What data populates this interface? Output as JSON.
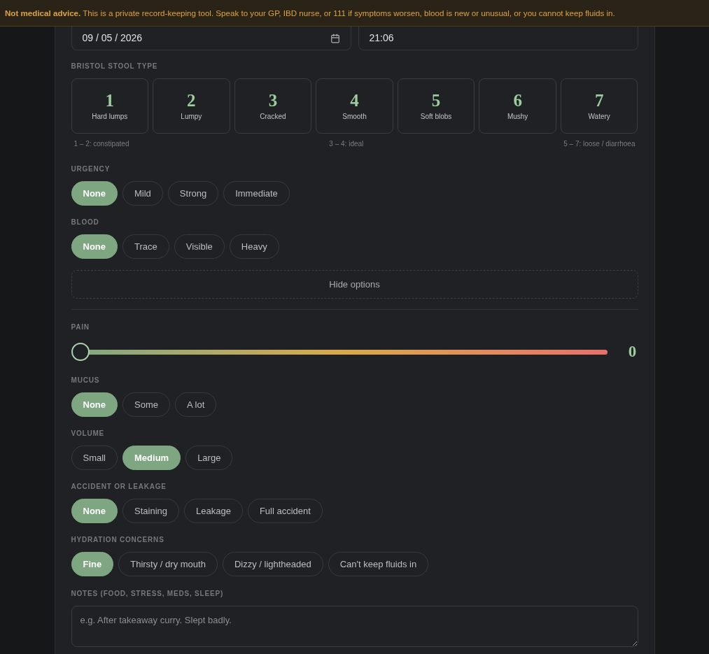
{
  "banner": {
    "text": "**Not medical advice.** This is a private record-keeping tool. Speak to your GP, IBD nurse, or 111 if symptoms worsen, blood is new or unusual, or you cannot keep fluids in."
  },
  "date_field": {
    "value": "09 / 05 / 2026"
  },
  "time_field": {
    "value": "21:06"
  },
  "stool_type": {
    "label": "BRISTOL STOOL TYPE",
    "options": [
      {
        "number": "1",
        "name": "Hard lumps",
        "selected": false
      },
      {
        "number": "2",
        "name": "Lumpy",
        "selected": false
      },
      {
        "number": "3",
        "name": "Cracked",
        "selected": false
      },
      {
        "number": "4",
        "name": "Smooth",
        "selected": false
      },
      {
        "number": "5",
        "name": "Soft blobs",
        "selected": false
      },
      {
        "number": "6",
        "name": "Mushy",
        "selected": false
      },
      {
        "number": "7",
        "name": "Watery",
        "selected": false
      }
    ],
    "scale": [
      "1 – 2: constipated",
      "3 – 4: ideal",
      "5 – 7: loose / diarrhoea"
    ]
  },
  "sections": [
    {
      "kind": "choice",
      "label": "URGENCY",
      "options": [
        {
          "label": "None",
          "selected": true
        },
        {
          "label": "Mild",
          "selected": false
        },
        {
          "label": "Strong",
          "selected": false
        },
        {
          "label": "Immediate",
          "selected": false
        }
      ]
    },
    {
      "kind": "choice",
      "label": "BLOOD",
      "options": [
        {
          "label": "None",
          "selected": true
        },
        {
          "label": "Trace",
          "selected": false
        },
        {
          "label": "Visible",
          "selected": false
        },
        {
          "label": "Heavy",
          "selected": false
        }
      ]
    },
    {
      "kind": "toggle",
      "label": "Hide options"
    },
    {
      "kind": "slider",
      "label": "PAIN",
      "level": 0,
      "reading": "0"
    },
    {
      "kind": "choice",
      "label": "MUCUS",
      "options": [
        {
          "label": "None",
          "selected": true
        },
        {
          "label": "Some",
          "selected": false
        },
        {
          "label": "A lot",
          "selected": false
        }
      ]
    },
    {
      "kind": "choice",
      "label": "VOLUME",
      "options": [
        {
          "label": "Small",
          "selected": false
        },
        {
          "label": "Medium",
          "selected": true
        },
        {
          "label": "Large",
          "selected": false
        }
      ]
    },
    {
      "kind": "choice",
      "label": "ACCIDENT OR LEAKAGE",
      "options": [
        {
          "label": "None",
          "selected": true
        },
        {
          "label": "Staining",
          "selected": false
        },
        {
          "label": "Leakage",
          "selected": false
        },
        {
          "label": "Full accident",
          "selected": false
        }
      ]
    },
    {
      "kind": "choice",
      "label": "HYDRATION CONCERNS",
      "options": [
        {
          "label": "Fine",
          "selected": true
        },
        {
          "label": "Thirsty / dry mouth",
          "selected": false
        },
        {
          "label": "Dizzy / lightheaded",
          "selected": false
        },
        {
          "label": "Can't keep fluids in",
          "selected": false
        }
      ]
    },
    {
      "kind": "notes",
      "label": "NOTES (FOOD, STRESS, MEDS, SLEEP)",
      "placeholder": "e.g. After takeaway curry. Slept badly."
    }
  ]
}
